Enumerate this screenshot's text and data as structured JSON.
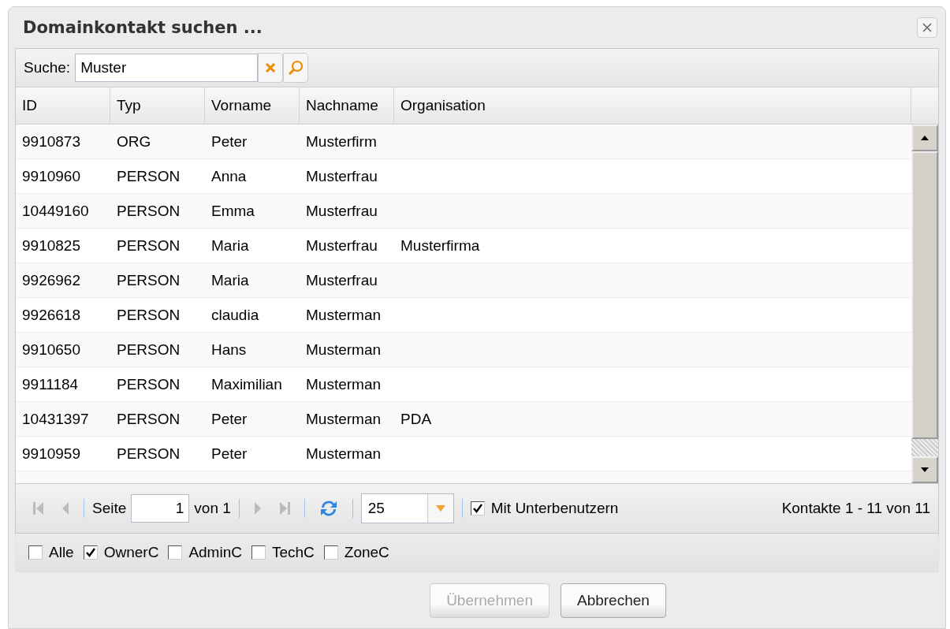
{
  "window": {
    "title": "Domainkontakt suchen ..."
  },
  "search": {
    "label": "Suche:",
    "value": "Muster"
  },
  "table": {
    "columns": [
      "ID",
      "Typ",
      "Vorname",
      "Nachname",
      "Organisation"
    ],
    "rows": [
      [
        "9910873",
        "ORG",
        "Peter",
        "Musterfirm",
        ""
      ],
      [
        "9910960",
        "PERSON",
        "Anna",
        "Musterfrau",
        ""
      ],
      [
        "10449160",
        "PERSON",
        "Emma",
        "Musterfrau",
        ""
      ],
      [
        "9910825",
        "PERSON",
        "Maria",
        "Musterfrau",
        "Musterfirma"
      ],
      [
        "9926962",
        "PERSON",
        "Maria",
        "Musterfrau",
        ""
      ],
      [
        "9926618",
        "PERSON",
        "claudia",
        "Musterman",
        ""
      ],
      [
        "9910650",
        "PERSON",
        "Hans",
        "Musterman",
        ""
      ],
      [
        "9911184",
        "PERSON",
        "Maximilian",
        "Musterman",
        ""
      ],
      [
        "10431397",
        "PERSON",
        "Peter",
        "Musterman",
        "PDA"
      ],
      [
        "9910959",
        "PERSON",
        "Peter",
        "Musterman",
        ""
      ]
    ]
  },
  "pager": {
    "page_label": "Seite",
    "page": "1",
    "of_label": "von 1",
    "page_size": "25",
    "subusers": {
      "label": "Mit Unterbenutzern",
      "checked": true
    },
    "summary": "Kontakte 1 - 11 von 11"
  },
  "filters": [
    {
      "label": "Alle",
      "checked": false
    },
    {
      "label": "OwnerC",
      "checked": true
    },
    {
      "label": "AdminC",
      "checked": false
    },
    {
      "label": "TechC",
      "checked": false
    },
    {
      "label": "ZoneC",
      "checked": false
    }
  ],
  "buttons": [
    {
      "label": "Übernehmen",
      "disabled": true
    },
    {
      "label": "Abbrechen",
      "disabled": false
    }
  ]
}
